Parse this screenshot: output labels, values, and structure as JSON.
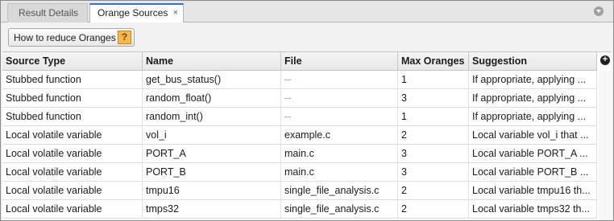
{
  "tabs": [
    {
      "label": "Result Details",
      "active": false
    },
    {
      "label": "Orange Sources",
      "active": true,
      "close_label": "×"
    }
  ],
  "toolbar": {
    "help_button_label": "How to reduce Oranges",
    "help_icon_glyph": "?"
  },
  "table": {
    "add_column_glyph": "+",
    "columns": [
      "Source Type",
      "Name",
      "File",
      "Max Oranges",
      "Suggestion"
    ],
    "rows": [
      [
        "Stubbed function",
        "get_bus_status()",
        "--",
        "1",
        "If appropriate, applying ..."
      ],
      [
        "Stubbed function",
        "random_float()",
        "--",
        "3",
        "If appropriate, applying ..."
      ],
      [
        "Stubbed function",
        "random_int()",
        "--",
        "1",
        "If appropriate, applying ..."
      ],
      [
        "Local volatile variable",
        "vol_i",
        "example.c",
        "2",
        "Local variable vol_i that ..."
      ],
      [
        "Local volatile variable",
        "PORT_A",
        "main.c",
        "3",
        "Local variable PORT_A ..."
      ],
      [
        "Local volatile variable",
        "PORT_B",
        "main.c",
        "3",
        "Local variable PORT_B ..."
      ],
      [
        "Local volatile variable",
        "tmpu16",
        "single_file_analysis.c",
        "2",
        "Local variable tmpu16 th..."
      ],
      [
        "Local volatile variable",
        "tmps32",
        "single_file_analysis.c",
        "2",
        "Local variable tmps32 th..."
      ]
    ]
  },
  "colors": {
    "active_tab_accent": "#2f6fd6",
    "help_icon_fill": "#f4b94a"
  },
  "icons": {
    "tab_close": "close-icon",
    "tabstrip_menu": "chevron-down-icon",
    "help": "help-icon",
    "add_column": "plus-icon"
  }
}
